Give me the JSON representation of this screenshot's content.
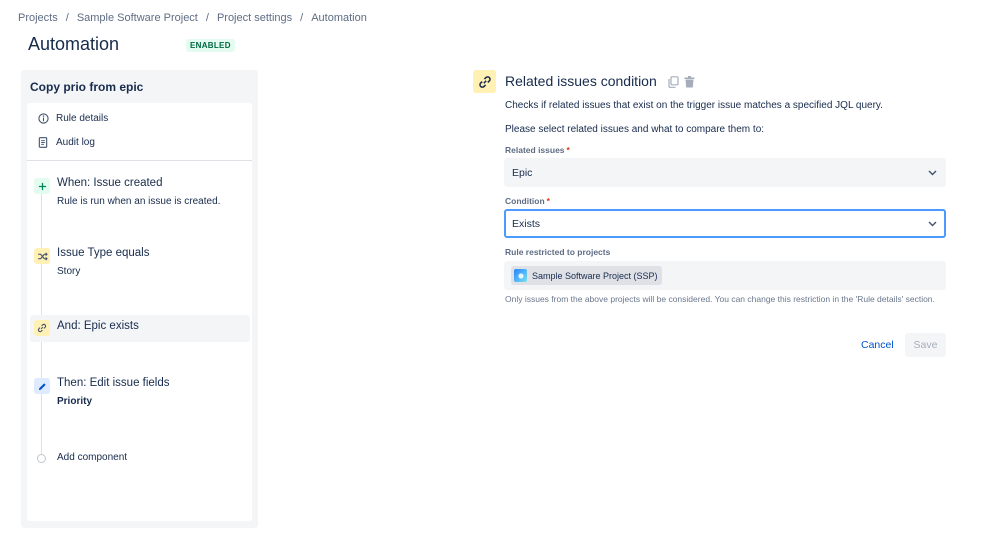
{
  "breadcrumb": {
    "items": [
      "Projects",
      "Sample Software Project",
      "Project settings",
      "Automation"
    ],
    "separator": "/"
  },
  "header": {
    "title": "Automation",
    "status": "ENABLED"
  },
  "rule": {
    "name": "Copy prio from epic",
    "menu": [
      {
        "label": "Rule details",
        "icon": "info-icon"
      },
      {
        "label": "Audit log",
        "icon": "document-icon"
      }
    ],
    "components": [
      {
        "title": "When: Issue created",
        "subtitle": "Rule is run when an issue is created.",
        "icon": "plus-icon",
        "color": "#e3fcef"
      },
      {
        "title": "Issue Type equals",
        "subtitle": "Story",
        "icon": "shuffle-icon",
        "color": "#fff0b3"
      },
      {
        "title": "And: Epic exists",
        "subtitle": "",
        "icon": "link-icon",
        "color": "#fff0b3",
        "selected": true
      },
      {
        "title": "Then: Edit issue fields",
        "subtitle": "Priority",
        "icon": "pencil-icon",
        "color": "#deebff"
      }
    ],
    "add_label": "Add component"
  },
  "condition": {
    "title": "Related issues condition",
    "description": "Checks if related issues that exist on the trigger issue matches a specified JQL query.",
    "instruction": "Please select related issues and what to compare them to:",
    "related_issues_label": "Related issues",
    "related_issues_value": "Epic",
    "condition_label": "Condition",
    "condition_value": "Exists",
    "required_mark": "*",
    "restricted_label": "Rule restricted to projects",
    "project_name": "Sample Software Project (SSP)",
    "help_text": "Only issues from the above projects will be considered. You can change this restriction in the 'Rule details' section.",
    "cancel_label": "Cancel",
    "save_label": "Save"
  },
  "colors": {
    "link": "#0052cc",
    "badge_bg": "#e3fcef",
    "badge_text": "#006644",
    "focus_border": "#4c9aff",
    "required": "#de350b"
  }
}
